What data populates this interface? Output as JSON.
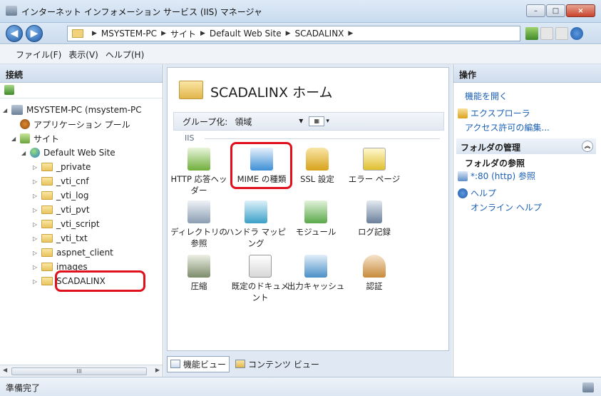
{
  "window": {
    "title": "インターネット インフォメーション サービス (IIS) マネージャ",
    "minimize": "–",
    "maximize": "□",
    "close": "×"
  },
  "address": {
    "crumbs": [
      "MSYSTEM-PC",
      "サイト",
      "Default Web Site",
      "SCADALINX"
    ],
    "separator": "▶"
  },
  "nav": {
    "back": "◀",
    "forward": "▶"
  },
  "menu": [
    "ファイル(F)",
    "表示(V)",
    "ヘルプ(H)"
  ],
  "connections": {
    "header": "接続",
    "tree": [
      {
        "label": "MSYSTEM-PC (msystem-PC",
        "level": 0,
        "icon": "server-icon"
      },
      {
        "label": "アプリケーション プール",
        "level": 1,
        "icon": "app-pool-icon"
      },
      {
        "label": "サイト",
        "level": 1,
        "icon": "sites-icon"
      },
      {
        "label": "Default Web Site",
        "level": 2,
        "icon": "globe-icon"
      },
      {
        "label": "_private",
        "level": 3,
        "icon": "folder-icon"
      },
      {
        "label": "_vti_cnf",
        "level": 3,
        "icon": "folder-icon"
      },
      {
        "label": "_vti_log",
        "level": 3,
        "icon": "folder-icon"
      },
      {
        "label": "_vti_pvt",
        "level": 3,
        "icon": "folder-icon"
      },
      {
        "label": "_vti_script",
        "level": 3,
        "icon": "folder-icon"
      },
      {
        "label": "_vti_txt",
        "level": 3,
        "icon": "folder-icon"
      },
      {
        "label": "aspnet_client",
        "level": 3,
        "icon": "folder-icon"
      },
      {
        "label": "images",
        "level": 3,
        "icon": "folder-icon"
      },
      {
        "label": "SCADALINX",
        "level": 3,
        "icon": "folder-icon"
      }
    ],
    "scroll_thumb": "III"
  },
  "home": {
    "title": "SCADALINX ホーム",
    "group_label": "グループ化:",
    "group_value": "領域",
    "group_arrow": "▾",
    "section": "IIS",
    "features": [
      {
        "label": "HTTP 応答ヘッダー",
        "icon": "http-headers-icon",
        "color": "#6fae3a"
      },
      {
        "label": "MIME の種類",
        "icon": "mime-types-icon",
        "color": "#3d8fd6"
      },
      {
        "label": "SSL 設定",
        "icon": "lock-icon",
        "color": "#d9a21b"
      },
      {
        "label": "エラー ページ",
        "icon": "error-page-icon",
        "color": "#e0c030"
      },
      {
        "label": "ディレクトリの参照",
        "icon": "directory-browse-icon",
        "color": "#8a9db3"
      },
      {
        "label": "ハンドラ マッピング",
        "icon": "handler-icon",
        "color": "#3aa0c8"
      },
      {
        "label": "モジュール",
        "icon": "modules-icon",
        "color": "#5aa84a"
      },
      {
        "label": "ログ記録",
        "icon": "log-icon",
        "color": "#6a7f9a"
      },
      {
        "label": "圧縮",
        "icon": "compression-icon",
        "color": "#7c8c6a"
      },
      {
        "label": "既定のドキュメント",
        "icon": "default-doc-icon",
        "color": "#3a3a3a"
      },
      {
        "label": "出力キャッシュ",
        "icon": "output-cache-icon",
        "color": "#4a90c8"
      },
      {
        "label": "認証",
        "icon": "auth-icon",
        "color": "#c88a3a"
      }
    ]
  },
  "tabs": {
    "features_view": "機能ビュー",
    "content_view": "コンテンツ ビュー"
  },
  "actions": {
    "header": "操作",
    "open_feature": "機能を開く",
    "explorer": "エクスプローラ",
    "edit_permissions": "アクセス許可の編集...",
    "folder_mgmt": "フォルダの管理",
    "folder_browse": "フォルダの参照",
    "browse_80": "*:80 (http) 参照",
    "help": "ヘルプ",
    "online_help": "オンライン ヘルプ",
    "collapse": "︽"
  },
  "status": {
    "text": "準備完了"
  }
}
